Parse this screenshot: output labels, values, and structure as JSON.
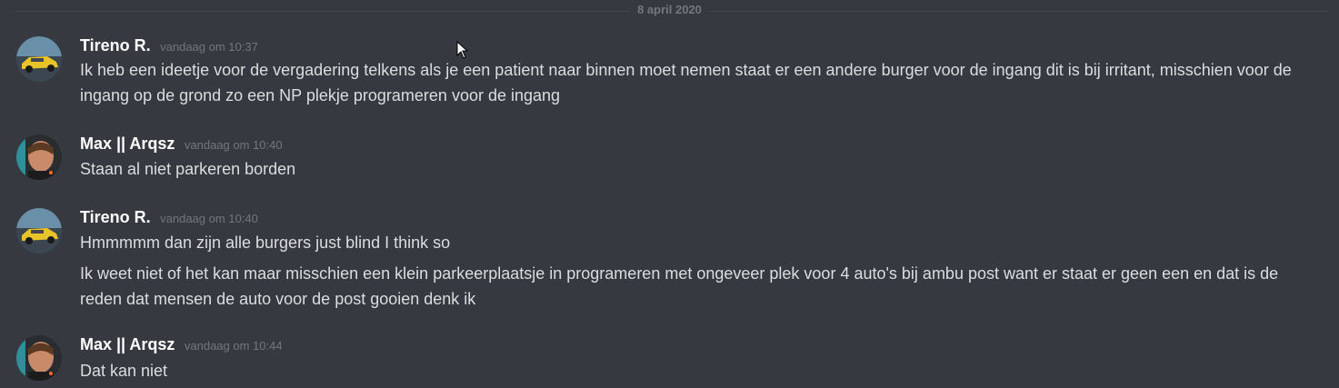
{
  "divider": {
    "date": "8 april 2020"
  },
  "messages": [
    {
      "author": "Tireno R.",
      "timestamp": "vandaag om 10:37",
      "avatar": "car-avatar",
      "lines": [
        "Ik heb een ideetje voor de vergadering telkens als je een patient naar binnen moet nemen staat er een andere burger  voor de ingang dit is bij irritant, misschien voor de ingang op de grond zo een NP plekje programeren voor de ingang"
      ]
    },
    {
      "author": "Max || Arqsz",
      "timestamp": "vandaag om 10:40",
      "avatar": "person-avatar",
      "lines": [
        "Staan al niet parkeren borden"
      ]
    },
    {
      "author": "Tireno R.",
      "timestamp": "vandaag om 10:40",
      "avatar": "car-avatar",
      "lines": [
        "Hmmmmm dan zijn alle burgers just blind I think so",
        "Ik weet niet of het kan maar misschien een klein parkeerplaatsje in programeren met ongeveer plek voor 4 auto's bij ambu post want er staat er geen een en dat is de reden dat mensen de auto voor de post gooien denk ik"
      ]
    },
    {
      "author": "Max || Arqsz",
      "timestamp": "vandaag om 10:44",
      "avatar": "person-avatar",
      "lines": [
        "Dat kan niet"
      ]
    }
  ],
  "colors": {
    "background": "#36393f",
    "username": "#ffffff",
    "message_text": "#dcddde",
    "timestamp": "#72767d"
  }
}
